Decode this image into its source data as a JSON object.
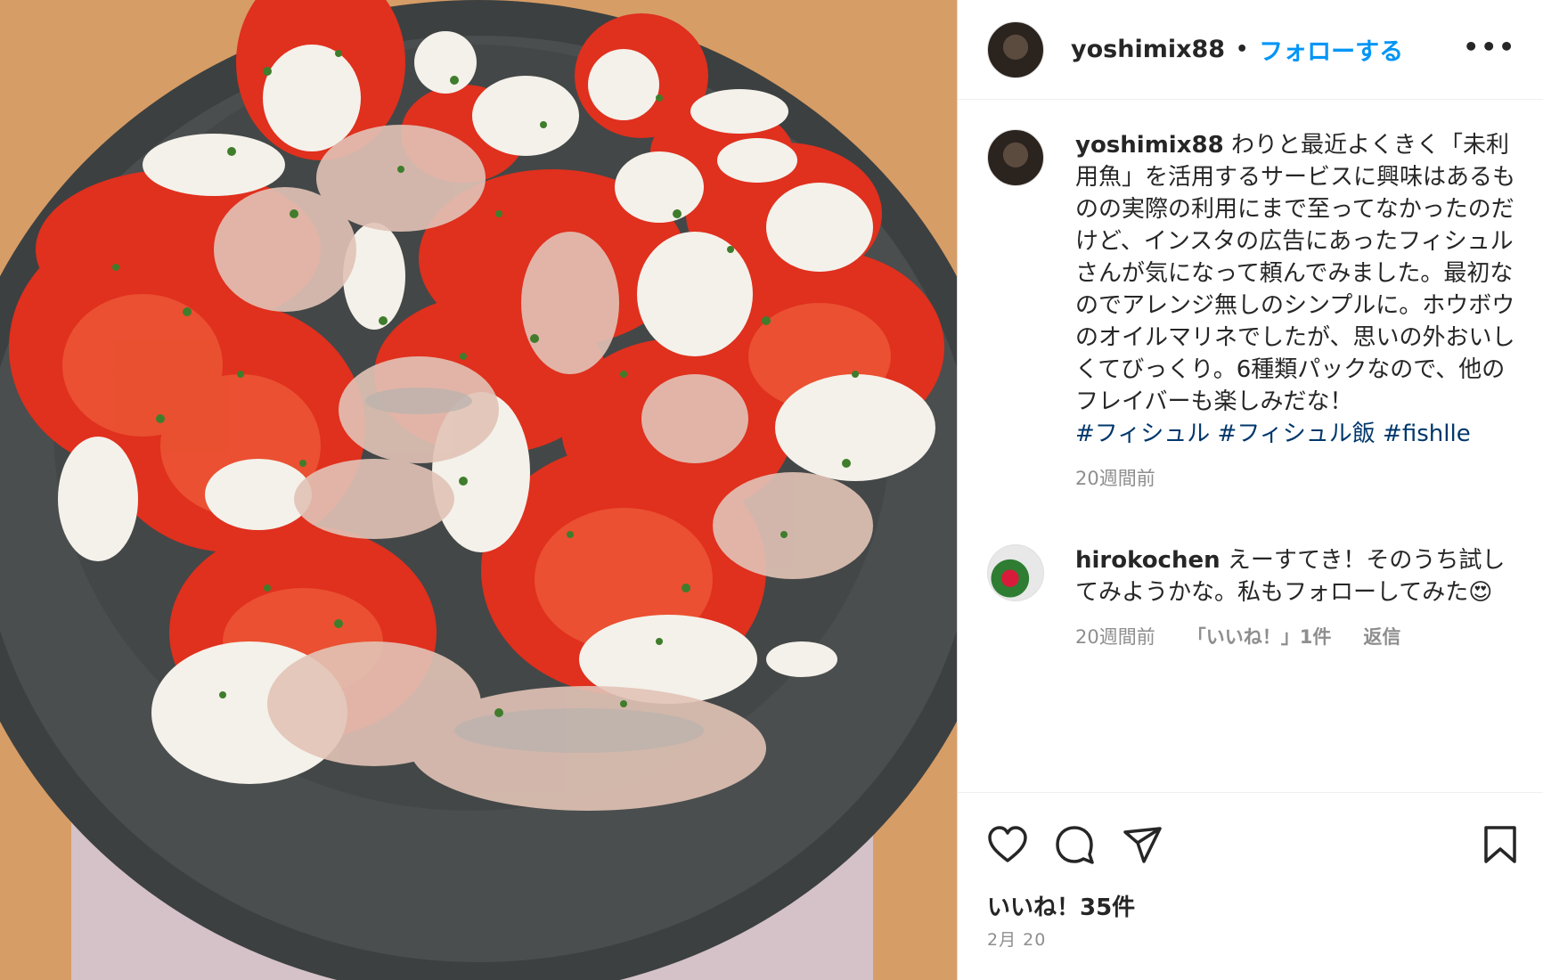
{
  "post": {
    "username": "yoshimix88",
    "follow_label": "フォローする",
    "more_label": "•••"
  },
  "caption": {
    "username": "yoshimix88",
    "text": "わりと最近よくきく「未利用魚」を活用するサービスに興味はあるものの実際の利用にまで至ってなかったのだけど、インスタの広告にあったフィシュルさんが気になって頼んでみました。最初なのでアレンジ無しのシンプルに。ホウボウのオイルマリネでしたが、思いの外おいしくてびっくり。6種類パックなので、他のフレイバーも楽しみだな！",
    "hashtags": "#フィシュル #フィシュル飯 #fishlle",
    "time": "20週間前"
  },
  "reply": {
    "username": "hirokochen",
    "text": "えーすてき！そのうち試してみようかな。私もフォローしてみた😍",
    "time": "20週間前",
    "likes": "「いいね！」1件",
    "reply_label": "返信"
  },
  "footer": {
    "likes": "いいね！35件",
    "date": "2月 20"
  },
  "icons": [
    "heart-icon",
    "comment-icon",
    "share-icon",
    "bookmark-icon"
  ],
  "colors": {
    "follow": "#0095f6",
    "hashtag": "#00376b",
    "muted": "#8e8e8e"
  }
}
